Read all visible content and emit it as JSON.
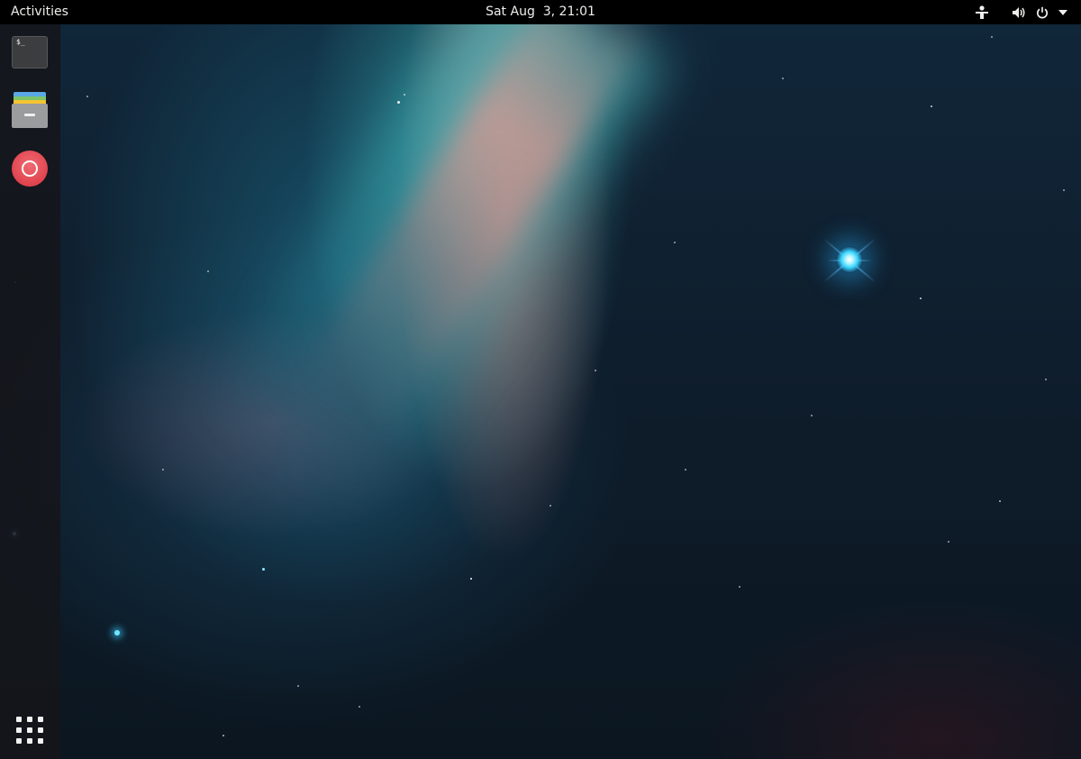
{
  "topbar": {
    "activities_label": "Activities",
    "clock": "Sat Aug  3, 21:01",
    "tray_icons": [
      "accessibility-icon",
      "volume-icon",
      "power-icon",
      "system-menu-arrow-icon"
    ]
  },
  "dash": {
    "items": [
      {
        "name": "Terminal",
        "icon": "terminal-icon",
        "prompt": "$_"
      },
      {
        "name": "Files",
        "icon": "files-icon"
      },
      {
        "name": "Help",
        "icon": "help-icon"
      }
    ],
    "show_apps_icon": "apps-grid-icon"
  },
  "colors": {
    "topbar_bg": "#000000",
    "dash_bg": "#14161a",
    "help_red": "#e0444d",
    "star_blue": "#39d6ff"
  }
}
